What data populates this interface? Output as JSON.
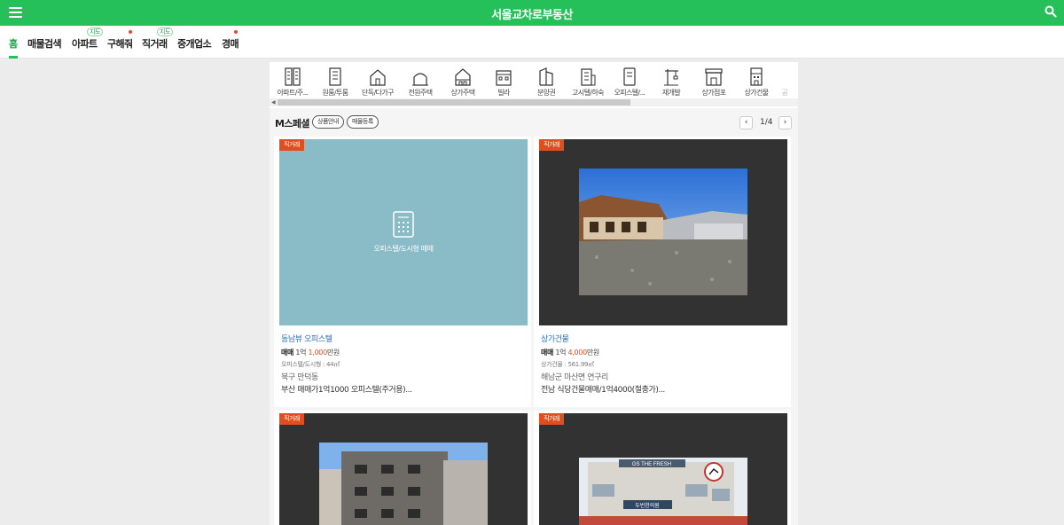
{
  "header": {
    "title": "서울교차로부동산",
    "menu_icon": "hamburger-menu-icon",
    "search_icon": "search-icon",
    "brand_color": "#25c05a"
  },
  "nav": {
    "items": [
      {
        "label": "홈"
      },
      {
        "label": "매물검색"
      },
      {
        "label": "아파트",
        "pill": "지도"
      },
      {
        "label": "구해줘"
      },
      {
        "label": "직거래",
        "pill": "지도"
      },
      {
        "label": "중개업소"
      },
      {
        "label": "경매"
      }
    ]
  },
  "categories": [
    {
      "label": "아파트/주...",
      "icon": "apartment-icon"
    },
    {
      "label": "원룸/투룸",
      "icon": "oneroom-icon"
    },
    {
      "label": "단독/다가구",
      "icon": "house-icon"
    },
    {
      "label": "전원주택",
      "icon": "country-house-icon"
    },
    {
      "label": "상가주택",
      "icon": "shop-house-icon"
    },
    {
      "label": "빌라",
      "icon": "villa-icon"
    },
    {
      "label": "분양권",
      "icon": "presale-icon"
    },
    {
      "label": "고시텔/하숙",
      "icon": "goshitel-icon"
    },
    {
      "label": "오피스텔/...",
      "icon": "officetel-icon"
    },
    {
      "label": "재개발",
      "icon": "redevelopment-icon"
    },
    {
      "label": "상가점포",
      "icon": "store-icon"
    },
    {
      "label": "상가건물",
      "icon": "commercial-building-icon"
    },
    {
      "label": "공",
      "icon": "more-icon"
    }
  ],
  "section": {
    "title": "M스페셜",
    "btn_info": "상품안내",
    "btn_register": "매물등록",
    "page": "1/4"
  },
  "listings": [
    {
      "badge": "직거래",
      "name": "동남뷰 오피스텔",
      "price_type": "매매",
      "price_a": "1억 ",
      "price_b": "1,000",
      "price_unit": "만원",
      "meta": "오피스텔/도시형 : 44㎡",
      "region": "북구 만덕동",
      "desc": "부산 매매가1억1000 오피스텔(주거용)...",
      "placeholder": "오피스텔/도시형 매매"
    },
    {
      "badge": "직거래",
      "name": "상가건물",
      "price_type": "매매",
      "price_a": "1억 ",
      "price_b": "4,000",
      "price_unit": "만원",
      "meta": "상가건물 : 561.99㎡",
      "region": "해남군 마산면 연구리",
      "desc": "전남 식당건물매매/1억4000(절충가)..."
    },
    {
      "badge": "직거래"
    },
    {
      "badge": "직거래",
      "sign_text": "GS THE FRESH",
      "sign_text2": "두번한의원"
    }
  ]
}
